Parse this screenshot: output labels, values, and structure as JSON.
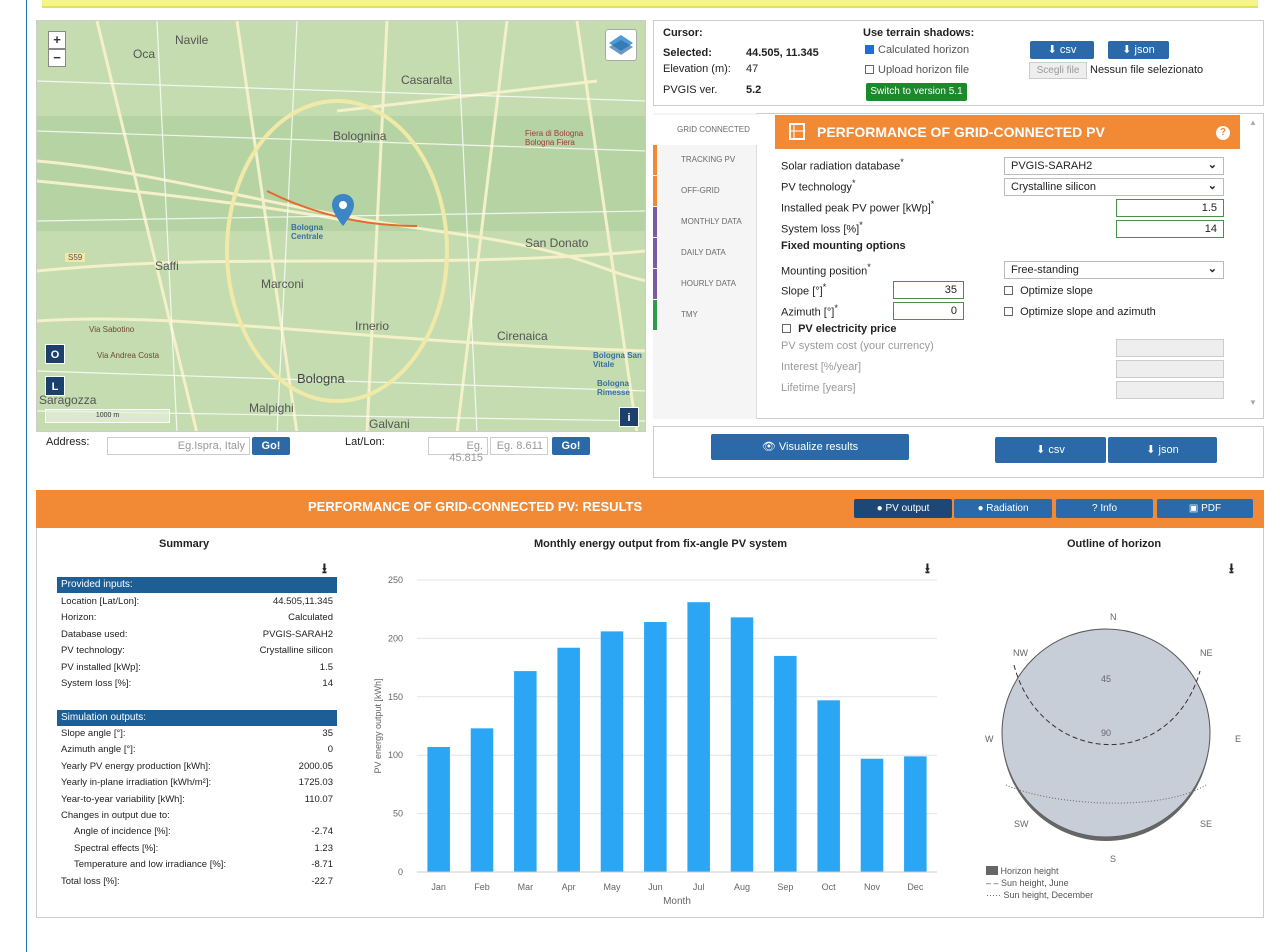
{
  "map": {
    "zoom_in": "+",
    "zoom_out": "−",
    "btn_o": "O",
    "btn_l": "L",
    "btn_i": "i",
    "scale": "1000 m",
    "labels": [
      "Navile",
      "Oca",
      "Casaralta",
      "Bolognina",
      "Bologna Centrale",
      "San Donato",
      "Saffi",
      "Marconi",
      "Irnerio",
      "Cirenaica",
      "Bologna",
      "Saragozza",
      "Malpighi",
      "Galvani",
      "S59",
      "Via Sabotino",
      "Via Andrea Costa",
      "Bologna San Vitale",
      "Bologna Rimesse",
      "Fiera di Bologna Bologna Fiera"
    ]
  },
  "address": {
    "label": "Address:",
    "placeholder": "Eg.Ispra, Italy",
    "go": "Go!",
    "latlon_label": "Lat/Lon:",
    "lat_placeholder": "Eg. 45.815",
    "lon_placeholder": "Eg. 8.611",
    "go2": "Go!"
  },
  "info": {
    "cursor_label": "Cursor:",
    "selected_label": "Selected:",
    "selected_value": "44.505, 11.345",
    "elevation_label": "Elevation (m):",
    "elevation_value": "47",
    "pvgis_label": "PVGIS ver.",
    "pvgis_value": "5.2",
    "terrain_label": "Use terrain shadows:",
    "calc_horizon": "Calculated horizon",
    "upload_horizon": "Upload horizon file",
    "switch_version": "Switch to version 5.1",
    "csv": "csv",
    "json": "json",
    "choose_file": "Scegli file",
    "no_file": "Nessun file selezionato"
  },
  "tabs": [
    "GRID CONNECTED",
    "TRACKING PV",
    "OFF-GRID",
    "MONTHLY DATA",
    "DAILY DATA",
    "HOURLY DATA",
    "TMY"
  ],
  "tab_colors": [
    "#ffffff",
    "#f28a35",
    "#f28a35",
    "#7a5aa0",
    "#7a5aa0",
    "#7a5aa0",
    "#2f9a48"
  ],
  "form": {
    "title": "PERFORMANCE OF GRID-CONNECTED PV",
    "help": "?",
    "db_label": "Solar radiation database",
    "db_value": "PVGIS-SARAH2",
    "tech_label": "PV technology",
    "tech_value": "Crystalline silicon",
    "peak_label": "Installed peak PV power [kWp]",
    "peak_value": "1.5",
    "loss_label": "System loss [%]",
    "loss_value": "14",
    "fixed_label": "Fixed mounting options",
    "mount_label": "Mounting position",
    "mount_value": "Free-standing",
    "slope_label": "Slope [°]",
    "slope_value": "35",
    "azimuth_label": "Azimuth [°]",
    "azimuth_value": "0",
    "opt_slope": "Optimize slope",
    "opt_both": "Optimize slope and azimuth",
    "price_label": "PV electricity price",
    "cost_label": "PV system cost (your currency)",
    "interest_label": "Interest [%/year]",
    "lifetime_label": "Lifetime [years]",
    "star": "*"
  },
  "actions": {
    "visualize": "Visualize results",
    "csv": "csv",
    "json": "json"
  },
  "results": {
    "title": "PERFORMANCE OF GRID-CONNECTED PV: RESULTS",
    "pv_output": "PV output",
    "radiation": "Radiation",
    "info": "Info",
    "pdf": "PDF"
  },
  "summary": {
    "title": "Summary",
    "inputs_head": "Provided inputs:",
    "inputs": [
      {
        "k": "Location [Lat/Lon]:",
        "v": "44.505,11.345"
      },
      {
        "k": "Horizon:",
        "v": "Calculated"
      },
      {
        "k": "Database used:",
        "v": "PVGIS-SARAH2"
      },
      {
        "k": "PV technology:",
        "v": "Crystalline silicon"
      },
      {
        "k": "PV installed [kWp]:",
        "v": "1.5"
      },
      {
        "k": "System loss [%]:",
        "v": "14"
      }
    ],
    "outputs_head": "Simulation outputs:",
    "outputs": [
      {
        "k": "Slope angle [°]:",
        "v": "35"
      },
      {
        "k": "Azimuth angle [°]:",
        "v": "0"
      },
      {
        "k": "Yearly PV energy production [kWh]:",
        "v": "2000.05"
      },
      {
        "k": "Yearly in-plane irradiation [kWh/m²]:",
        "v": "1725.03"
      },
      {
        "k": "Year-to-year variability [kWh]:",
        "v": "110.07"
      },
      {
        "k": "Changes in output due to:",
        "v": ""
      },
      {
        "k": "Angle of incidence [%]:",
        "v": "-2.74"
      },
      {
        "k": "Spectral effects [%]:",
        "v": "1.23"
      },
      {
        "k": "Temperature and low irradiance [%]:",
        "v": "-8.71"
      },
      {
        "k": "Total loss [%]:",
        "v": "-22.7"
      }
    ]
  },
  "chart_data": [
    {
      "type": "bar",
      "title": "Monthly energy output from fix-angle PV system",
      "xlabel": "Month",
      "ylabel": "PV energy output [kWh]",
      "categories": [
        "Jan",
        "Feb",
        "Mar",
        "Apr",
        "May",
        "Jun",
        "Jul",
        "Aug",
        "Sep",
        "Oct",
        "Nov",
        "Dec"
      ],
      "values": [
        107,
        123,
        172,
        192,
        206,
        214,
        231,
        218,
        185,
        147,
        97,
        99
      ],
      "ylim": [
        0,
        250
      ],
      "yticks": [
        0,
        50,
        100,
        150,
        200,
        250
      ],
      "grid": true,
      "color": "#2aa6f5"
    }
  ],
  "horizon": {
    "title": "Outline of horizon",
    "dirs": {
      "n": "N",
      "ne": "NE",
      "e": "E",
      "se": "SE",
      "s": "S",
      "sw": "SW",
      "w": "W",
      "nw": "NW"
    },
    "r45": "45",
    "r90": "90",
    "legend": [
      "Horizon height",
      "Sun height, June",
      "Sun height, December"
    ]
  },
  "download_icon": "download-icon"
}
